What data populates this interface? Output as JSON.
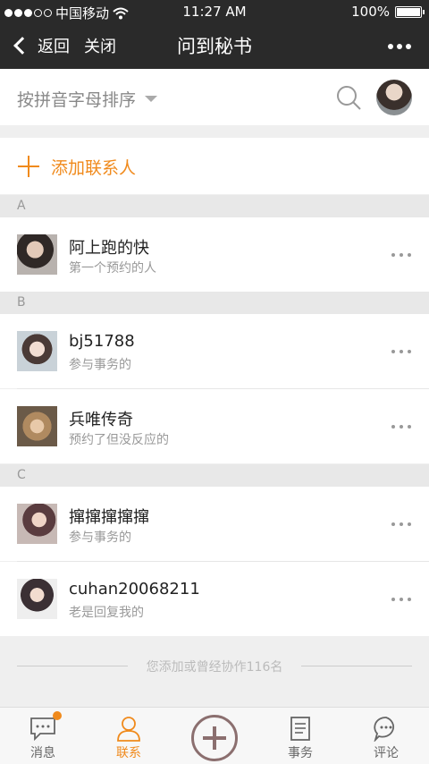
{
  "status": {
    "carrier": "中国移动",
    "time": "11:27 AM",
    "battery": "100%"
  },
  "header": {
    "back_label": "返回",
    "close_label": "关闭",
    "title": "问到秘书"
  },
  "sortbar": {
    "sort_label": "按拼音字母排序"
  },
  "add_contact": {
    "label": "添加联系人"
  },
  "sections": [
    {
      "letter": "A",
      "contacts": [
        {
          "name": "阿上跑的快",
          "desc": "第一个预约的人"
        }
      ]
    },
    {
      "letter": "B",
      "contacts": [
        {
          "name": "bj51788",
          "desc": "参与事务的"
        },
        {
          "name": "兵唯传奇",
          "desc": "预约了但没反应的"
        }
      ]
    },
    {
      "letter": "C",
      "contacts": [
        {
          "name": "撺撺撺撺撺",
          "desc": "参与事务的"
        },
        {
          "name": "cuhan20068211",
          "desc": "老是回复我的"
        }
      ]
    }
  ],
  "footer_note": "您添加或曾经协作116名",
  "tabs": [
    {
      "label": "消息",
      "icon": "message-icon"
    },
    {
      "label": "联系",
      "icon": "contact-icon"
    },
    {
      "label": "",
      "icon": "add-icon"
    },
    {
      "label": "事务",
      "icon": "task-icon"
    },
    {
      "label": "评论",
      "icon": "comment-icon"
    }
  ],
  "colors": {
    "accent": "#f08a1c",
    "header_bg": "#2a2a2a"
  }
}
